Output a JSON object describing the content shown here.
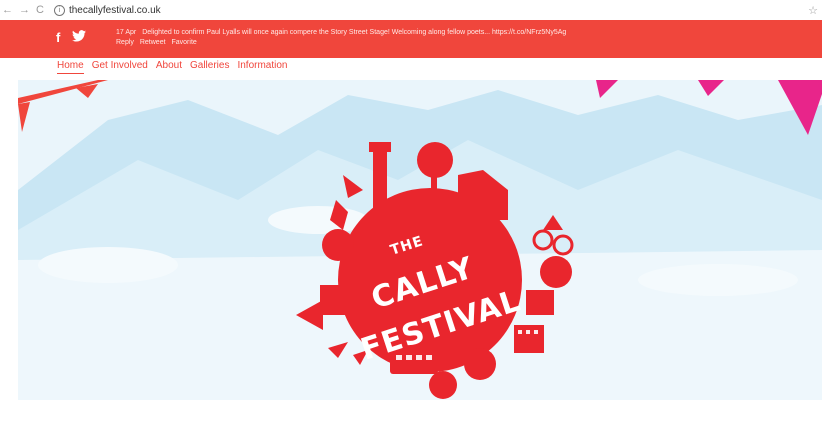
{
  "browser": {
    "back_icon": "arrow-left-icon",
    "forward_icon": "arrow-right-icon",
    "reload_icon": "reload-icon",
    "url": "thecallyfestival.co.uk"
  },
  "tweet": {
    "date": "17 Apr",
    "text": "Delighted to confirm Paul Lyalls will once again compere the Story Street Stage! Welcoming along fellow poets... https://t.co/NFrz5Ny5Ag",
    "reply": "Reply",
    "retweet": "Retweet",
    "favorite": "Favorite"
  },
  "nav": {
    "items": [
      "Home",
      "Get Involved",
      "About",
      "Galleries",
      "Information"
    ]
  },
  "logo": {
    "line1": "THE",
    "line2": "CALLY",
    "line3": "FESTIVAL"
  },
  "colors": {
    "brand_red": "#f0463c",
    "sky": "#dff0f8",
    "mountain": "#b7dcef",
    "bunting_pink": "#e8258a"
  }
}
